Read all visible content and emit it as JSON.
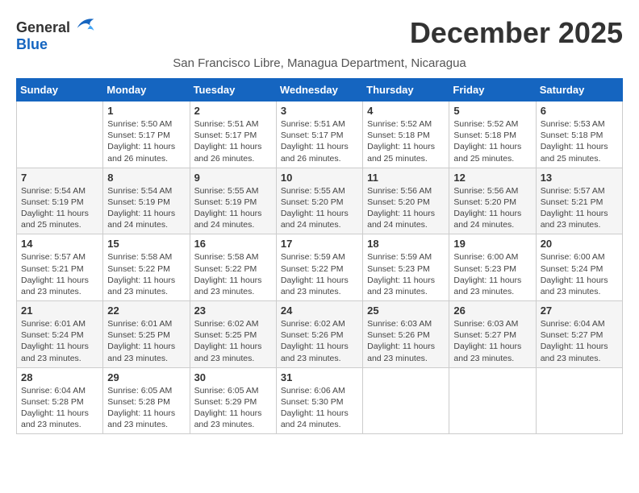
{
  "logo": {
    "general": "General",
    "blue": "Blue"
  },
  "title": "December 2025",
  "subtitle": "San Francisco Libre, Managua Department, Nicaragua",
  "days": [
    "Sunday",
    "Monday",
    "Tuesday",
    "Wednesday",
    "Thursday",
    "Friday",
    "Saturday"
  ],
  "weeks": [
    [
      {
        "day": "",
        "content": ""
      },
      {
        "day": "1",
        "content": "Sunrise: 5:50 AM\nSunset: 5:17 PM\nDaylight: 11 hours\nand 26 minutes."
      },
      {
        "day": "2",
        "content": "Sunrise: 5:51 AM\nSunset: 5:17 PM\nDaylight: 11 hours\nand 26 minutes."
      },
      {
        "day": "3",
        "content": "Sunrise: 5:51 AM\nSunset: 5:17 PM\nDaylight: 11 hours\nand 26 minutes."
      },
      {
        "day": "4",
        "content": "Sunrise: 5:52 AM\nSunset: 5:18 PM\nDaylight: 11 hours\nand 25 minutes."
      },
      {
        "day": "5",
        "content": "Sunrise: 5:52 AM\nSunset: 5:18 PM\nDaylight: 11 hours\nand 25 minutes."
      },
      {
        "day": "6",
        "content": "Sunrise: 5:53 AM\nSunset: 5:18 PM\nDaylight: 11 hours\nand 25 minutes."
      }
    ],
    [
      {
        "day": "7",
        "content": "Sunrise: 5:54 AM\nSunset: 5:19 PM\nDaylight: 11 hours\nand 25 minutes."
      },
      {
        "day": "8",
        "content": "Sunrise: 5:54 AM\nSunset: 5:19 PM\nDaylight: 11 hours\nand 24 minutes."
      },
      {
        "day": "9",
        "content": "Sunrise: 5:55 AM\nSunset: 5:19 PM\nDaylight: 11 hours\nand 24 minutes."
      },
      {
        "day": "10",
        "content": "Sunrise: 5:55 AM\nSunset: 5:20 PM\nDaylight: 11 hours\nand 24 minutes."
      },
      {
        "day": "11",
        "content": "Sunrise: 5:56 AM\nSunset: 5:20 PM\nDaylight: 11 hours\nand 24 minutes."
      },
      {
        "day": "12",
        "content": "Sunrise: 5:56 AM\nSunset: 5:20 PM\nDaylight: 11 hours\nand 24 minutes."
      },
      {
        "day": "13",
        "content": "Sunrise: 5:57 AM\nSunset: 5:21 PM\nDaylight: 11 hours\nand 23 minutes."
      }
    ],
    [
      {
        "day": "14",
        "content": "Sunrise: 5:57 AM\nSunset: 5:21 PM\nDaylight: 11 hours\nand 23 minutes."
      },
      {
        "day": "15",
        "content": "Sunrise: 5:58 AM\nSunset: 5:22 PM\nDaylight: 11 hours\nand 23 minutes."
      },
      {
        "day": "16",
        "content": "Sunrise: 5:58 AM\nSunset: 5:22 PM\nDaylight: 11 hours\nand 23 minutes."
      },
      {
        "day": "17",
        "content": "Sunrise: 5:59 AM\nSunset: 5:22 PM\nDaylight: 11 hours\nand 23 minutes."
      },
      {
        "day": "18",
        "content": "Sunrise: 5:59 AM\nSunset: 5:23 PM\nDaylight: 11 hours\nand 23 minutes."
      },
      {
        "day": "19",
        "content": "Sunrise: 6:00 AM\nSunset: 5:23 PM\nDaylight: 11 hours\nand 23 minutes."
      },
      {
        "day": "20",
        "content": "Sunrise: 6:00 AM\nSunset: 5:24 PM\nDaylight: 11 hours\nand 23 minutes."
      }
    ],
    [
      {
        "day": "21",
        "content": "Sunrise: 6:01 AM\nSunset: 5:24 PM\nDaylight: 11 hours\nand 23 minutes."
      },
      {
        "day": "22",
        "content": "Sunrise: 6:01 AM\nSunset: 5:25 PM\nDaylight: 11 hours\nand 23 minutes."
      },
      {
        "day": "23",
        "content": "Sunrise: 6:02 AM\nSunset: 5:25 PM\nDaylight: 11 hours\nand 23 minutes."
      },
      {
        "day": "24",
        "content": "Sunrise: 6:02 AM\nSunset: 5:26 PM\nDaylight: 11 hours\nand 23 minutes."
      },
      {
        "day": "25",
        "content": "Sunrise: 6:03 AM\nSunset: 5:26 PM\nDaylight: 11 hours\nand 23 minutes."
      },
      {
        "day": "26",
        "content": "Sunrise: 6:03 AM\nSunset: 5:27 PM\nDaylight: 11 hours\nand 23 minutes."
      },
      {
        "day": "27",
        "content": "Sunrise: 6:04 AM\nSunset: 5:27 PM\nDaylight: 11 hours\nand 23 minutes."
      }
    ],
    [
      {
        "day": "28",
        "content": "Sunrise: 6:04 AM\nSunset: 5:28 PM\nDaylight: 11 hours\nand 23 minutes."
      },
      {
        "day": "29",
        "content": "Sunrise: 6:05 AM\nSunset: 5:28 PM\nDaylight: 11 hours\nand 23 minutes."
      },
      {
        "day": "30",
        "content": "Sunrise: 6:05 AM\nSunset: 5:29 PM\nDaylight: 11 hours\nand 23 minutes."
      },
      {
        "day": "31",
        "content": "Sunrise: 6:06 AM\nSunset: 5:30 PM\nDaylight: 11 hours\nand 24 minutes."
      },
      {
        "day": "",
        "content": ""
      },
      {
        "day": "",
        "content": ""
      },
      {
        "day": "",
        "content": ""
      }
    ]
  ]
}
